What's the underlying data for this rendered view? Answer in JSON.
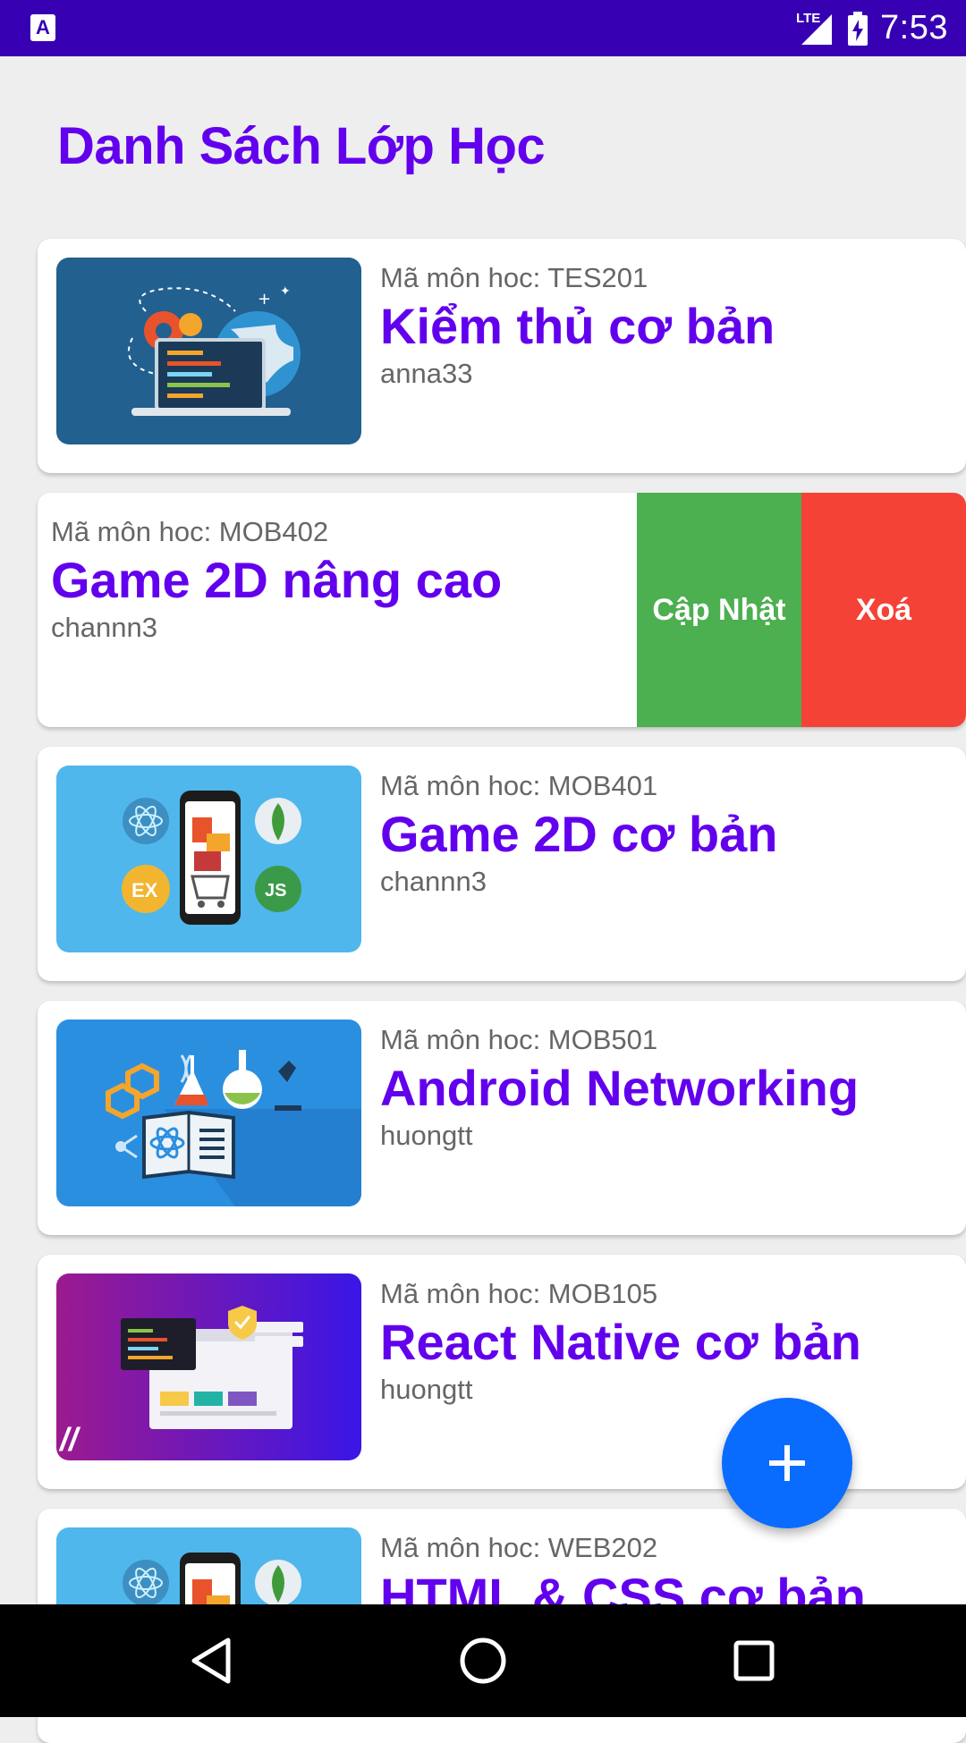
{
  "status_bar": {
    "network": "LTE",
    "time": "7:53"
  },
  "page": {
    "title": "Danh Sách Lớp Học"
  },
  "courses": [
    {
      "code_label": "Mã môn hoc: TES201",
      "name": "Kiểm thủ cơ bản",
      "teacher": "anna33",
      "thumb": "testing-illustration"
    },
    {
      "code_label": "Mã môn hoc: MOB402",
      "name": "Game 2D nâng cao",
      "teacher": "channn3",
      "swiped": true
    },
    {
      "code_label": "Mã môn hoc: MOB401",
      "name": "Game 2D cơ bản",
      "teacher": "channn3",
      "thumb": "mobile-app-illustration"
    },
    {
      "code_label": "Mã môn hoc: MOB501",
      "name": "Android Networking",
      "teacher": "huongtt",
      "thumb": "science-illustration"
    },
    {
      "code_label": "Mã môn hoc: MOB105",
      "name": "React Native cơ bản",
      "teacher": "huongtt",
      "thumb": "web-dev-illustration"
    },
    {
      "code_label": "Mã môn hoc: WEB202",
      "name": "HTML & CSS cơ bản",
      "teacher": "",
      "thumb": "mobile-app-illustration"
    }
  ],
  "swipe_actions": {
    "update_label": "Cập Nhật",
    "delete_label": "Xoá",
    "update_color": "#4caf50",
    "delete_color": "#f44336"
  },
  "fab": {
    "icon": "plus-icon",
    "color": "#0a6cff"
  },
  "nav_bar": {
    "back_icon": "back-icon",
    "home_icon": "home-icon",
    "recents_icon": "recents-icon"
  },
  "colors": {
    "primary": "#6200ee",
    "status_bar": "#3700b3"
  }
}
